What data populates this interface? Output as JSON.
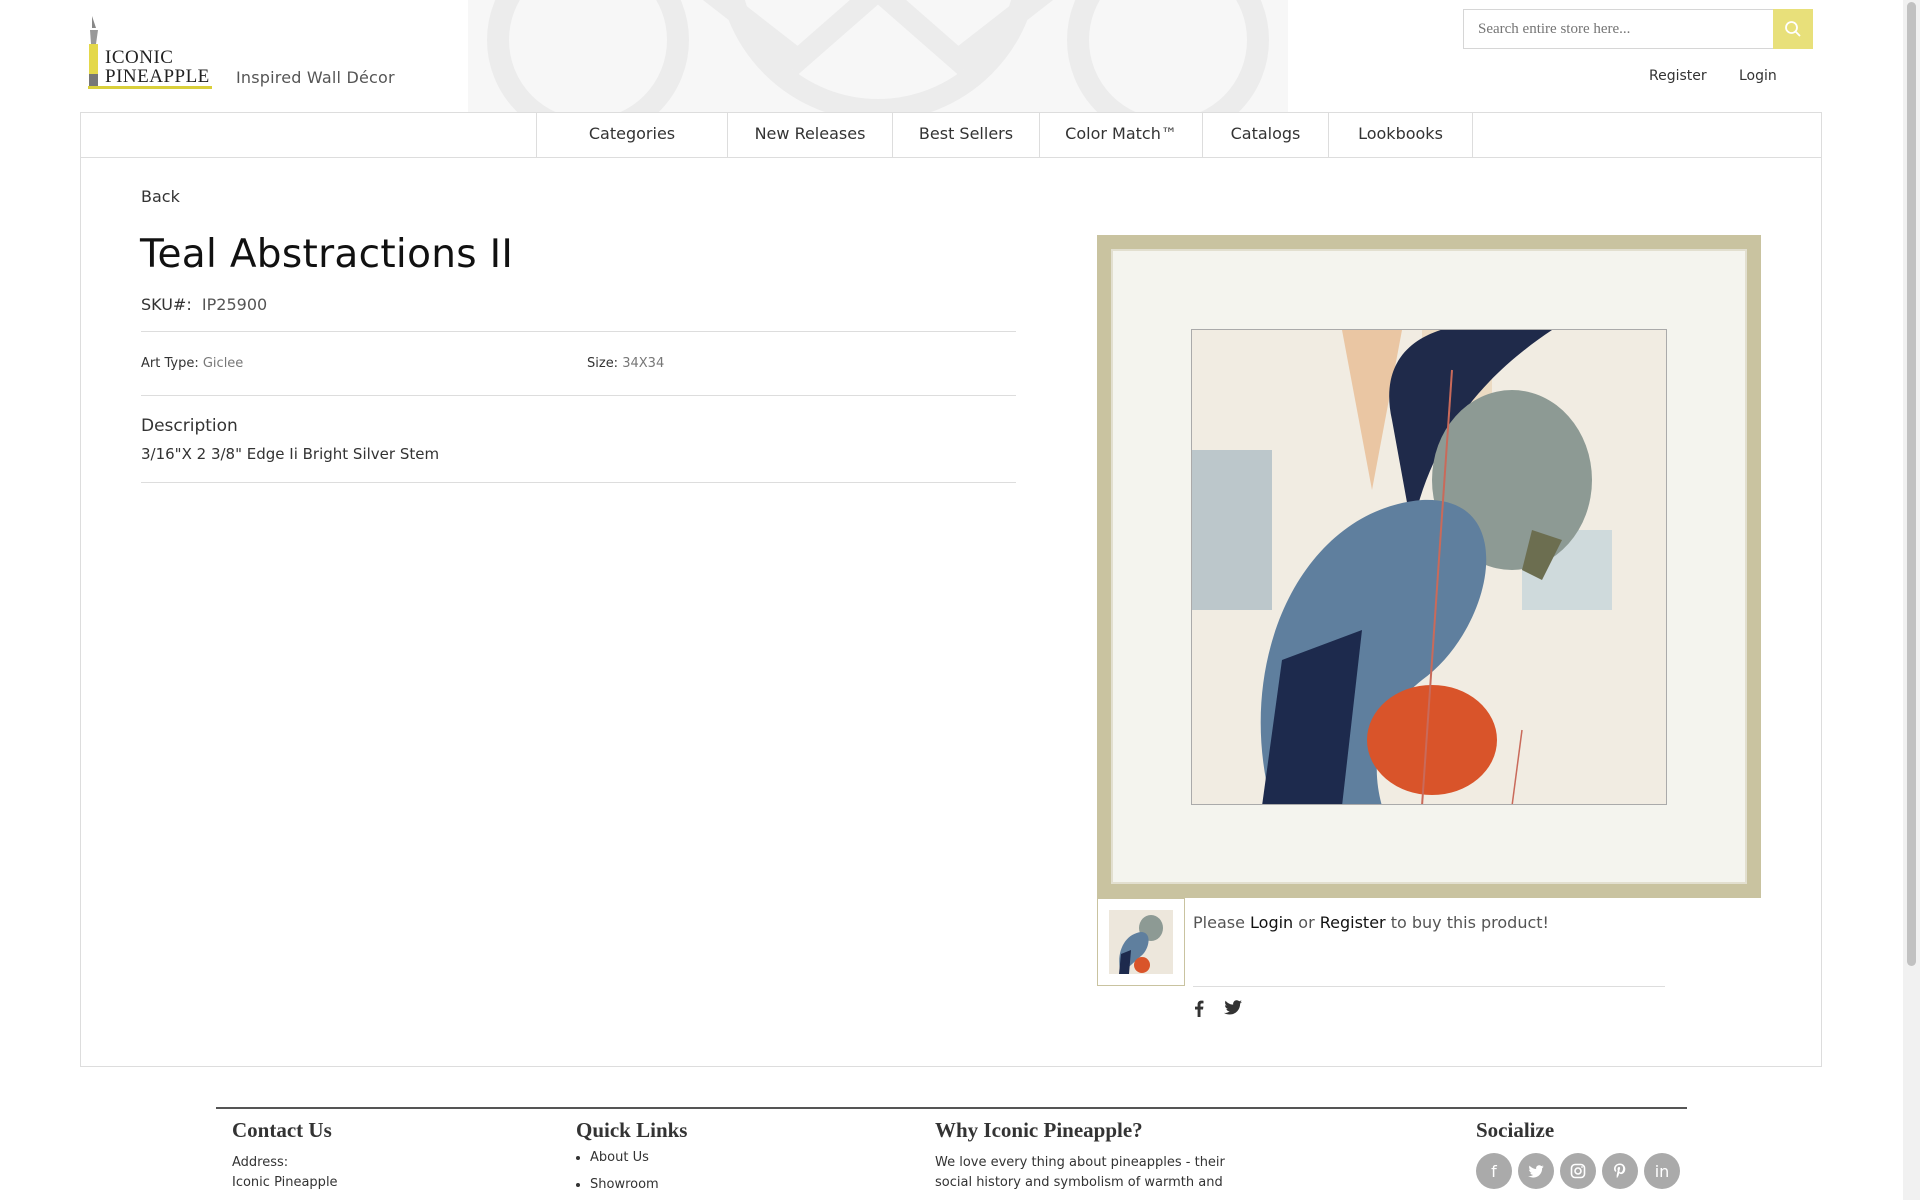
{
  "header": {
    "logo_text_line1": "ICONIC",
    "logo_text_line2": "PINEAPPLE",
    "tagline": "Inspired Wall Décor",
    "search_placeholder": "Search entire store here...",
    "register_label": "Register",
    "login_label": "Login"
  },
  "nav": {
    "items": [
      {
        "label": "Categories"
      },
      {
        "label": "New Releases"
      },
      {
        "label": "Best Sellers"
      },
      {
        "label": "Color Match™"
      },
      {
        "label": "Catalogs"
      },
      {
        "label": "Lookbooks"
      }
    ]
  },
  "product": {
    "back_label": "Back",
    "title": "Teal Abstractions II",
    "sku_label": "SKU#:",
    "sku": "IP25900",
    "art_type_label": "Art Type:",
    "art_type": "Giclee",
    "size_label": "Size:",
    "size": "34X34",
    "description_heading": "Description",
    "description": "3/16\"X 2 3/8\" Edge Ii Bright Silver Stem",
    "buy_prefix": "Please",
    "buy_login": "Login",
    "buy_or": "or",
    "buy_register": "Register",
    "buy_suffix": "to buy this product!"
  },
  "share": {
    "icons": [
      "facebook-icon",
      "twitter-icon"
    ]
  },
  "footer": {
    "contact_heading": "Contact Us",
    "address_label": "Address:",
    "address_line1": "Iconic Pineapple",
    "quicklinks_heading": "Quick Links",
    "quicklinks": [
      "About Us",
      "Showroom"
    ],
    "why_heading": "Why Iconic Pineapple?",
    "why_text": "We love every thing about pineapples - their social history and symbolism of warmth and",
    "socialize_heading": "Socialize",
    "social_icons": [
      "facebook-icon",
      "twitter-icon",
      "instagram-icon",
      "pinterest-icon",
      "linkedin-icon"
    ]
  },
  "colors": {
    "accent": "#e8e07a",
    "frame_gold": "#c9c3a0",
    "social_grey": "#aaaaaa"
  }
}
